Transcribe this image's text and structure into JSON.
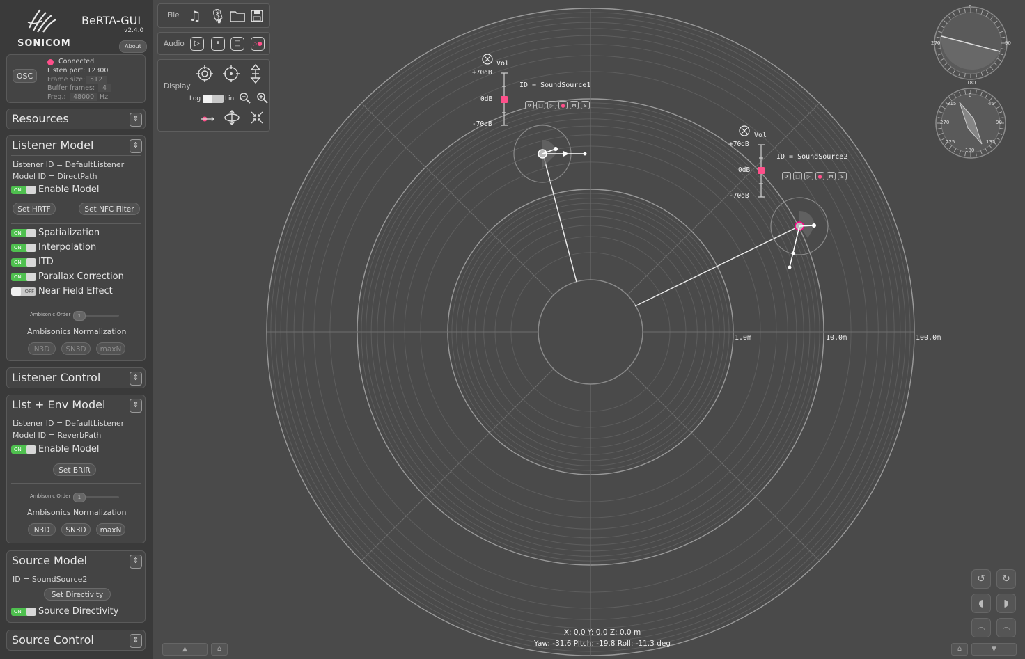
{
  "app": {
    "org": "SONICOM",
    "title": "BeRTA-GUI",
    "version": "v2.4.0",
    "about": "About"
  },
  "osc": {
    "button": "OSC",
    "status": "Connected",
    "listen_port": "Listen port: 12300",
    "frame_size_label": "Frame size:",
    "frame_size": "512",
    "buffer_label": "Buffer frames:",
    "buffer": "4",
    "freq_label": "Freq.:",
    "freq": "48000",
    "freq_unit": "Hz",
    "status_color": "#ff4f8a"
  },
  "panels": {
    "resources": {
      "title": "Resources"
    },
    "listener_model": {
      "title": "Listener Model",
      "listener_id": "Listener ID  =  DefaultListener",
      "model_id": "Model ID  =  DirectPath",
      "enable": "Enable Model",
      "set_hrtf": "Set HRTF",
      "set_nfc": "Set NFC Filter",
      "toggles": [
        {
          "label": "Spatialization",
          "state": "ON"
        },
        {
          "label": "Interpolation",
          "state": "ON"
        },
        {
          "label": "ITD",
          "state": "ON"
        },
        {
          "label": "Parallax Correction",
          "state": "ON"
        },
        {
          "label": "Near Field Effect",
          "state": "OFF"
        }
      ],
      "ambi_order_label": "Ambisonic Order",
      "ambi_order": "1",
      "ambi_norm": "Ambisonics Normalization",
      "norms": [
        "N3D",
        "SN3D",
        "maxN"
      ]
    },
    "listener_control": {
      "title": "Listener Control"
    },
    "list_env": {
      "title": "List + Env Model",
      "listener_id": "Listener ID  =  DefaultListener",
      "model_id": "Model ID  =  ReverbPath",
      "enable": "Enable Model",
      "set_brir": "Set BRIR",
      "ambi_order_label": "Ambisonic Order",
      "ambi_order": "1",
      "ambi_norm": "Ambisonics Normalization",
      "norms": [
        "N3D",
        "SN3D",
        "maxN"
      ]
    },
    "source_model": {
      "title": "Source Model",
      "id": "ID  =  SoundSource2",
      "set_directivity": "Set Directivity",
      "source_directivity": "Source Directivity"
    },
    "source_control": {
      "title": "Source Control"
    }
  },
  "switch": {
    "on": "ON",
    "off": "OFF"
  },
  "toolbar": {
    "file": "File",
    "audio": "Audio",
    "display": "Display",
    "log": "Log",
    "lin": "Lin",
    "audio_buttons": [
      "▷",
      "⏸",
      "□",
      "▷●"
    ]
  },
  "radar": {
    "scale_labels": [
      "1.0m",
      "10.0m",
      "100.0m"
    ]
  },
  "sources": [
    {
      "id": "ID  =  SoundSource1",
      "vol": "Vol",
      "plus": "+70dB",
      "zero": "0dB",
      "minus": "-70dB"
    },
    {
      "id": "ID  =  SoundSource2",
      "vol": "Vol",
      "plus": "+70dB",
      "zero": "0dB",
      "minus": "-70dB"
    }
  ],
  "source_controls": [
    "⟳",
    "□",
    "▷",
    "●",
    "M",
    "S"
  ],
  "position": {
    "line1": "X: 0.0  Y: 0.0  Z: 0.0 m",
    "line2": "Yaw: -31.6 Pitch: -19.8 Roll: -11.3 deg"
  },
  "compass": {
    "n": "0",
    "e": "90",
    "s": "180",
    "w": "270",
    "ne": "45",
    "se": "135",
    "sw": "225",
    "nw": "315"
  },
  "accent": "#ff4f8a"
}
